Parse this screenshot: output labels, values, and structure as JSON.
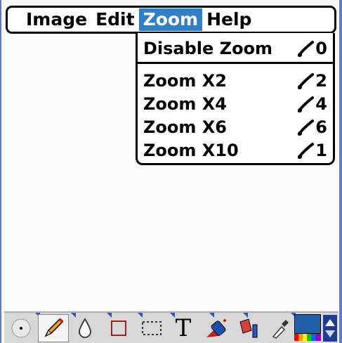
{
  "menubar": {
    "items": [
      {
        "label": "Image",
        "active": false
      },
      {
        "label": "Edit",
        "active": false
      },
      {
        "label": "Zoom",
        "active": true
      },
      {
        "label": "Help",
        "active": false
      }
    ]
  },
  "zoom_menu": {
    "items": [
      {
        "label": "Disable Zoom",
        "shortcut": "0"
      },
      {
        "label": "Zoom X2",
        "shortcut": "2"
      },
      {
        "label": "Zoom X4",
        "shortcut": "4"
      },
      {
        "label": "Zoom X6",
        "shortcut": "6"
      },
      {
        "label": "Zoom X10",
        "shortcut": "1"
      }
    ]
  },
  "toolbar": {
    "tools": [
      "brush-size",
      "pencil",
      "drop",
      "rectangle",
      "selection-rect",
      "text",
      "spray-can",
      "paint-bucket",
      "eyedropper",
      "color-palette",
      "scroll-arrow"
    ],
    "text_tool_label": "T",
    "colors": {
      "selected_color": "#1f5fa8",
      "accent": "#2f80c8"
    }
  }
}
